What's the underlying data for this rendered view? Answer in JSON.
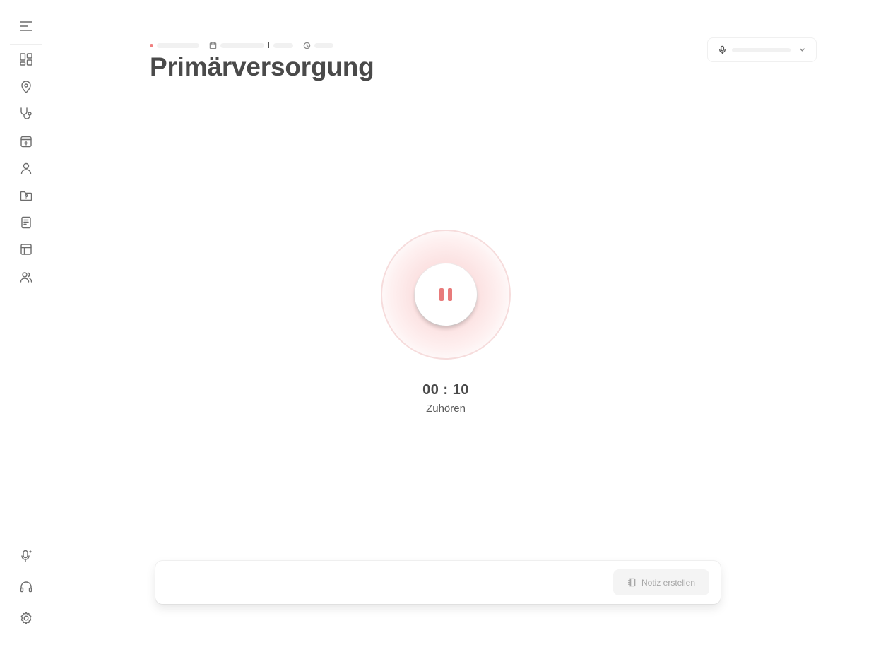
{
  "header": {
    "title": "Primärversorgung",
    "status_color": "#f08080"
  },
  "recorder": {
    "timer": "00 : 10",
    "status": "Zuhören",
    "accent": "#e87b7b",
    "state": "recording"
  },
  "actions": {
    "create_note": "Notiz erstellen"
  },
  "sidebar": {
    "items": [
      {
        "name": "menu-icon"
      },
      {
        "name": "dashboard-icon"
      },
      {
        "name": "location-pin-icon"
      },
      {
        "name": "stethoscope-icon"
      },
      {
        "name": "calendar-add-icon"
      },
      {
        "name": "user-icon"
      },
      {
        "name": "folder-question-icon"
      },
      {
        "name": "document-icon"
      },
      {
        "name": "table-icon"
      },
      {
        "name": "users-icon"
      },
      {
        "name": "microphone-sparkle-icon"
      },
      {
        "name": "headset-icon"
      },
      {
        "name": "gear-icon"
      }
    ]
  }
}
